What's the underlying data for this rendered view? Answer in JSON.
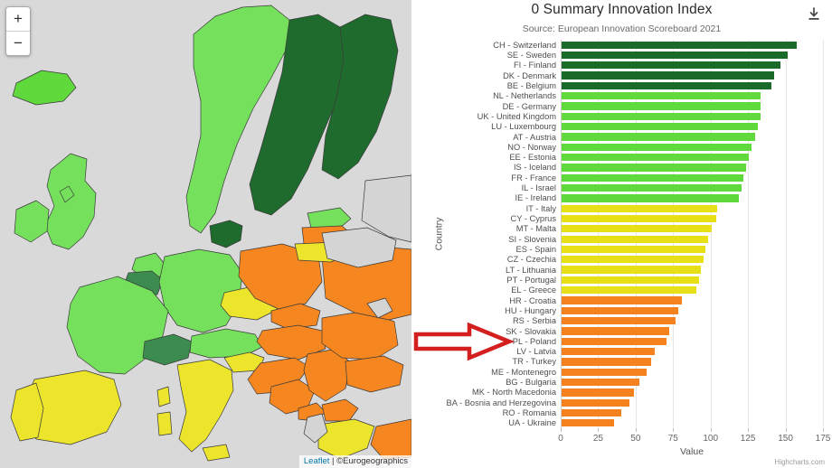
{
  "map": {
    "zoom_in_label": "+",
    "zoom_out_label": "−",
    "attribution_leaflet": "Leaflet",
    "attribution_separator": " | ",
    "attribution_source": "©Eurogeographics",
    "colors": {
      "background": "#d9d9d9",
      "no_data": "#d4d4d4",
      "dark_green": "#3c8c4f",
      "light_green": "#74e05c",
      "yellow": "#ece52c",
      "orange": "#f6861f",
      "border": "#3a3a3a"
    }
  },
  "chart": {
    "title": "0 Summary Innovation Index",
    "subtitle": "Source: European Innovation Scoreboard 2021",
    "credits": "Highcharts.com",
    "export_icon": "download-icon"
  },
  "chart_data": {
    "type": "bar",
    "title": "0 Summary Innovation Index",
    "subtitle": "Source: European Innovation Scoreboard 2021",
    "xlabel": "Value",
    "ylabel": "Country",
    "xlim": [
      0,
      175
    ],
    "xticks": [
      0,
      25,
      50,
      75,
      100,
      125,
      150,
      175
    ],
    "grid": true,
    "legend": false,
    "orientation": "horizontal",
    "categories": [
      "CH - Switzerland",
      "SE - Sweden",
      "FI - Finland",
      "DK - Denmark",
      "BE - Belgium",
      "NL - Netherlands",
      "DE - Germany",
      "UK - United Kingdom",
      "LU - Luxembourg",
      "AT - Austria",
      "NO - Norway",
      "EE - Estonia",
      "IS - Iceland",
      "FR - France",
      "IL - Israel",
      "IE - Ireland",
      "IT - Italy",
      "CY - Cyprus",
      "MT - Malta",
      "SI - Slovenia",
      "ES - Spain",
      "CZ - Czechia",
      "LT - Lithuania",
      "PT - Portugal",
      "EL - Greece",
      "HR - Croatia",
      "HU - Hungary",
      "RS - Serbia",
      "SK - Slovakia",
      "PL - Poland",
      "LV - Latvia",
      "TR - Turkey",
      "ME - Montenegro",
      "BG - Bulgaria",
      "MK - North Macedonia",
      "BA - Bosnia and Herzegovina",
      "RO - Romania",
      "UA - Ukraine"
    ],
    "values": [
      157,
      151,
      146,
      142,
      140,
      133,
      133,
      133,
      131,
      129,
      127,
      125,
      123,
      121,
      120,
      118,
      104,
      103,
      100,
      98,
      96,
      95,
      93,
      92,
      90,
      80,
      78,
      76,
      72,
      70,
      62,
      60,
      57,
      52,
      48,
      45,
      40,
      35
    ],
    "colors": [
      "#1a6b2a",
      "#1a6b2a",
      "#1a6b2a",
      "#1a6b2a",
      "#1a6b2a",
      "#5fd93c",
      "#5fd93c",
      "#5fd93c",
      "#5fd93c",
      "#5fd93c",
      "#5fd93c",
      "#5fd93c",
      "#5fd93c",
      "#5fd93c",
      "#5fd93c",
      "#5fd93c",
      "#e8e016",
      "#e8e016",
      "#e8e016",
      "#e8e016",
      "#e8e016",
      "#e8e016",
      "#e8e016",
      "#e8e016",
      "#e8e016",
      "#f5821f",
      "#f5821f",
      "#f5821f",
      "#f5821f",
      "#f5821f",
      "#f5821f",
      "#f5821f",
      "#f5821f",
      "#f5821f",
      "#f5821f",
      "#f5821f",
      "#f5821f",
      "#f5821f"
    ],
    "annotation": {
      "type": "arrow",
      "points_to": "PL - Poland",
      "color": "#d41f1f"
    }
  }
}
